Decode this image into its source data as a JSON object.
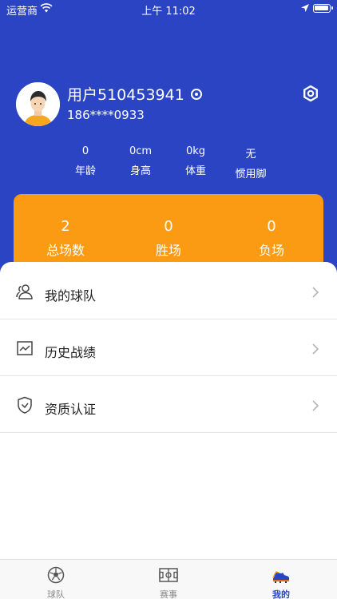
{
  "status_bar": {
    "carrier": "运营商",
    "time": "上午 11:02"
  },
  "profile": {
    "username": "用户510453941",
    "phone": "186****0933"
  },
  "stats": [
    {
      "value": "0",
      "label": "年龄"
    },
    {
      "value": "0cm",
      "label": "身高"
    },
    {
      "value": "0kg",
      "label": "体重"
    },
    {
      "value": "无",
      "label": "惯用脚"
    }
  ],
  "record": [
    {
      "value": "2",
      "label": "总场数"
    },
    {
      "value": "0",
      "label": "胜场"
    },
    {
      "value": "0",
      "label": "负场"
    }
  ],
  "menu": [
    {
      "label": "我的球队",
      "icon": "team-icon"
    },
    {
      "label": "历史战绩",
      "icon": "chart-icon"
    },
    {
      "label": "资质认证",
      "icon": "shield-icon"
    }
  ],
  "tabs": [
    {
      "label": "球队",
      "icon": "soccer-ball-icon"
    },
    {
      "label": "赛事",
      "icon": "field-icon"
    },
    {
      "label": "我的",
      "icon": "cleat-icon"
    }
  ],
  "colors": {
    "primary": "#2a44c4",
    "accent": "#fb9b13"
  }
}
